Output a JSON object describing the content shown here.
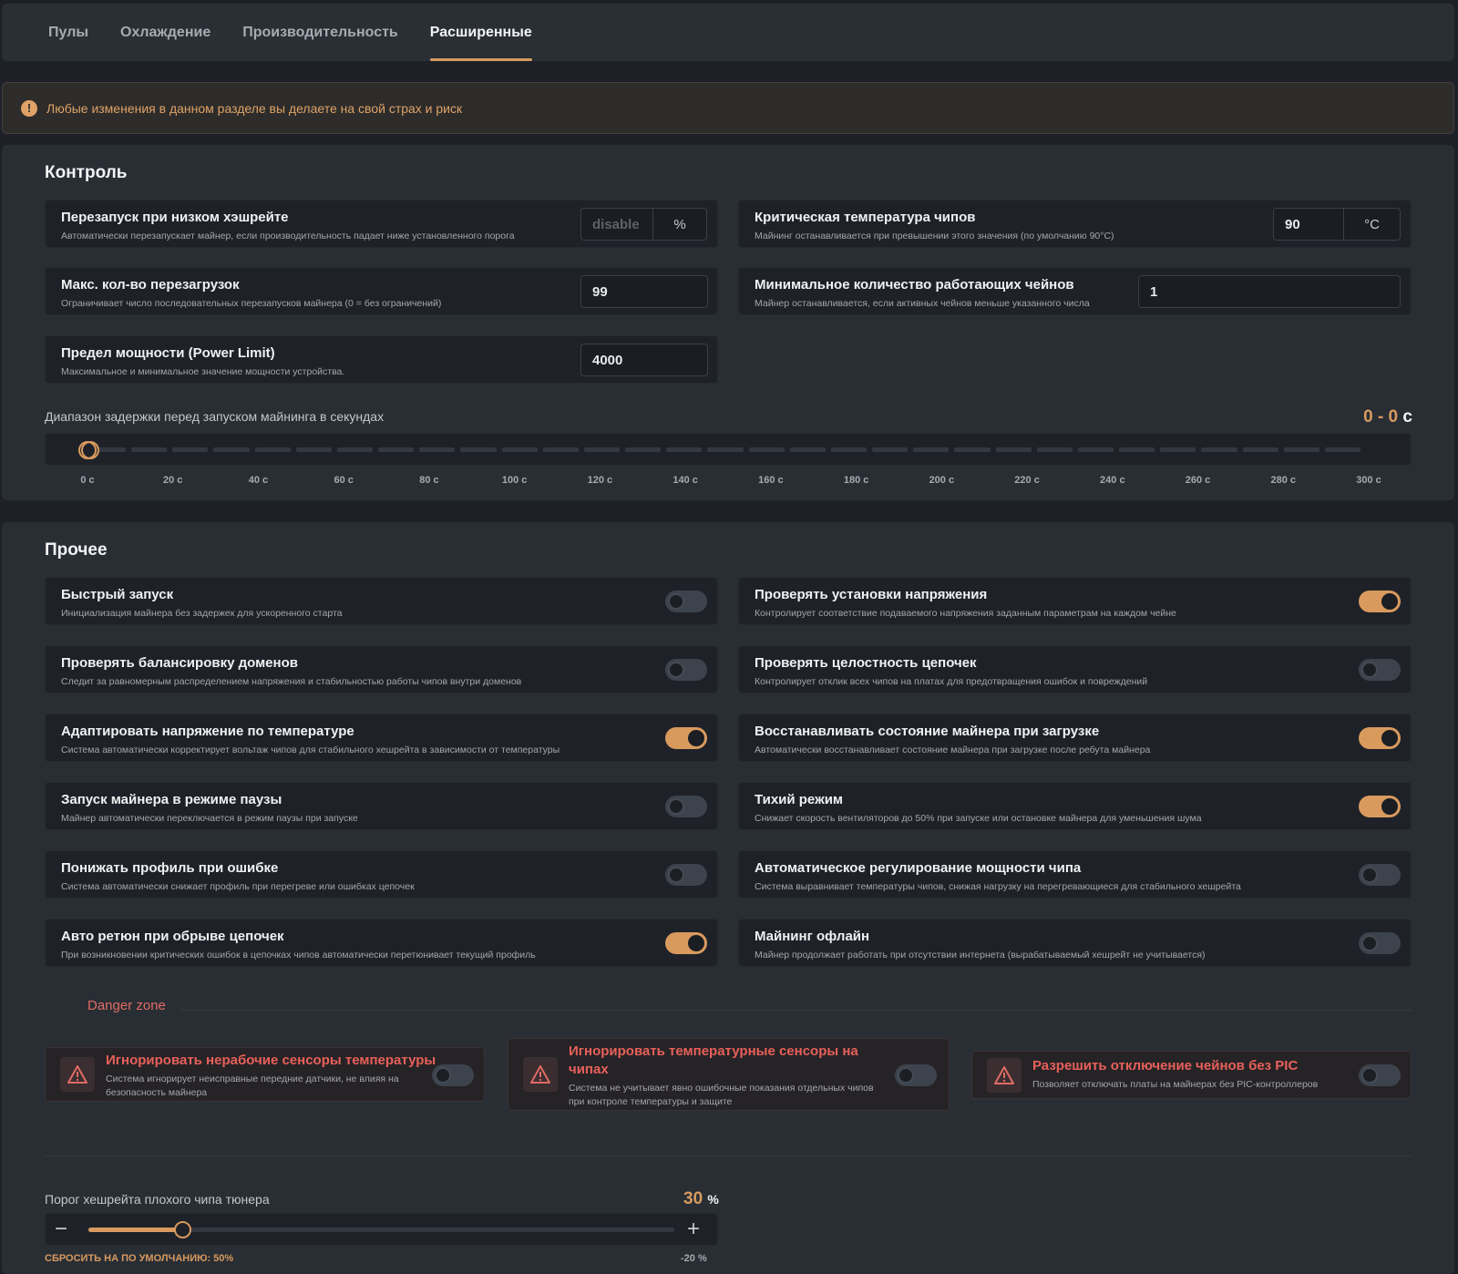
{
  "tabs": [
    {
      "label": "Пулы",
      "active": false
    },
    {
      "label": "Охлаждение",
      "active": false
    },
    {
      "label": "Производительность",
      "active": false
    },
    {
      "label": "Расширенные",
      "active": true
    }
  ],
  "warning": {
    "text": "Любые изменения в данном разделе вы делаете на свой страх и риск"
  },
  "control": {
    "title": "Контроль",
    "restart_low_hash": {
      "title": "Перезапуск при низком хэшрейте",
      "desc": "Автоматически перезапускает майнер, если производительность падает ниже установленного порога",
      "value": "disable",
      "unit": "%"
    },
    "critical_temp": {
      "title": "Критическая температура чипов",
      "desc": "Майнинг останавливается при превышении этого значения (по умолчанию 90°C)",
      "value": "90",
      "unit": "°C"
    },
    "max_reboots": {
      "title": "Макс. кол-во перезагрузок",
      "desc": "Ограничивает число последовательных перезапусков майнера (0 = без ограничений)",
      "value": "99"
    },
    "min_chains": {
      "title": "Минимальное количество работающих чейнов",
      "desc": "Майнер останавливается, если активных чейнов меньше указанного числа",
      "value": "1"
    },
    "power_limit": {
      "title": "Предел мощности (Power Limit)",
      "desc": "Максимальное и минимальное значение мощности устройства.",
      "value": "4000"
    },
    "delay_range": {
      "label": "Диапазон задержки перед запуском майнинга в секундах",
      "value_text": "0 - 0",
      "unit": "с",
      "min": 0,
      "max": 300,
      "low": 0,
      "high": 0,
      "ticks": [
        "0 с",
        "20 с",
        "40 с",
        "60 с",
        "80 с",
        "100 с",
        "120 с",
        "140 с",
        "160 с",
        "180 с",
        "200 с",
        "220 с",
        "240 с",
        "260 с",
        "280 с",
        "300 с"
      ]
    }
  },
  "other": {
    "title": "Прочее",
    "toggles": [
      {
        "title": "Быстрый запуск",
        "desc": "Инициализация майнера без задержек для ускоренного старта",
        "on": false
      },
      {
        "title": "Проверять установки напряжения",
        "desc": "Контролирует соответствие подаваемого напряжения заданным параметрам на каждом чейне",
        "on": true
      },
      {
        "title": "Проверять балансировку доменов",
        "desc": "Следит за равномерным распределением напряжения и стабильностью работы чипов внутри доменов",
        "on": false
      },
      {
        "title": "Проверять целостность цепочек",
        "desc": "Контролирует отклик всех чипов на платах для предотвращения ошибок и повреждений",
        "on": false
      },
      {
        "title": "Адаптировать напряжение по температуре",
        "desc": "Система автоматически корректирует вольтаж чипов для стабильного хешрейта в зависимости от температуры",
        "on": true
      },
      {
        "title": "Восстанавливать состояние майнера при загрузке",
        "desc": "Автоматически восстанавливает состояние майнера при загрузке после ребута майнера",
        "on": true
      },
      {
        "title": "Запуск майнера в режиме паузы",
        "desc": "Майнер автоматически переключается в режим паузы при запуске",
        "on": false
      },
      {
        "title": "Тихий режим",
        "desc": "Снижает скорость вентиляторов до 50% при запуске или остановке майнера для уменьшения шума",
        "on": true
      },
      {
        "title": "Понижать профиль при ошибке",
        "desc": "Система автоматически снижает профиль при перегреве или ошибках цепочек",
        "on": false
      },
      {
        "title": "Автоматическое регулирование мощности чипа",
        "desc": "Система выравнивает температуры чипов, снижая нагрузку на перегревающиеся для стабильного хешрейта",
        "on": false
      },
      {
        "title": "Авто ретюн при обрыве цепочек",
        "desc": "При возникновении критических ошибок в цепочках чипов автоматически перетюнивает текущий профиль",
        "on": true
      },
      {
        "title": "Майнинг офлайн",
        "desc": "Майнер продолжает работать при отсутствии интернета (вырабатываемый хешрейт не учитывается)",
        "on": false
      }
    ],
    "danger_zone": {
      "title": "Danger zone",
      "items": [
        {
          "title_lines": [
            "Игнорировать нерабочие сенсоры температуры"
          ],
          "desc_lines": [
            "Система игнорирует неисправные передние датчики, не влияя на",
            "безопасность майнера"
          ],
          "on": false
        },
        {
          "title_lines": [
            "Игнорировать температурные сенсоры на",
            "чипах"
          ],
          "desc_lines": [
            "Система не учитывает явно ошибочные показания отдельных чипов",
            "при контроле температуры и защите"
          ],
          "on": false
        },
        {
          "title_lines": [
            "Разрешить отключение чейнов без PIC"
          ],
          "desc_lines": [
            "Позволяет отключать платы на майнерах без PIC-контроллеров"
          ],
          "on": false
        }
      ]
    },
    "bad_chip": {
      "label": "Порог хешрейта плохого чипа тюнера",
      "value": "30",
      "unit": "%",
      "fraction": 0.16,
      "reset_label": "СБРОСИТЬ НА ПО УМОЛЧАНИЮ: 50%",
      "min_label": "-20 %"
    }
  }
}
